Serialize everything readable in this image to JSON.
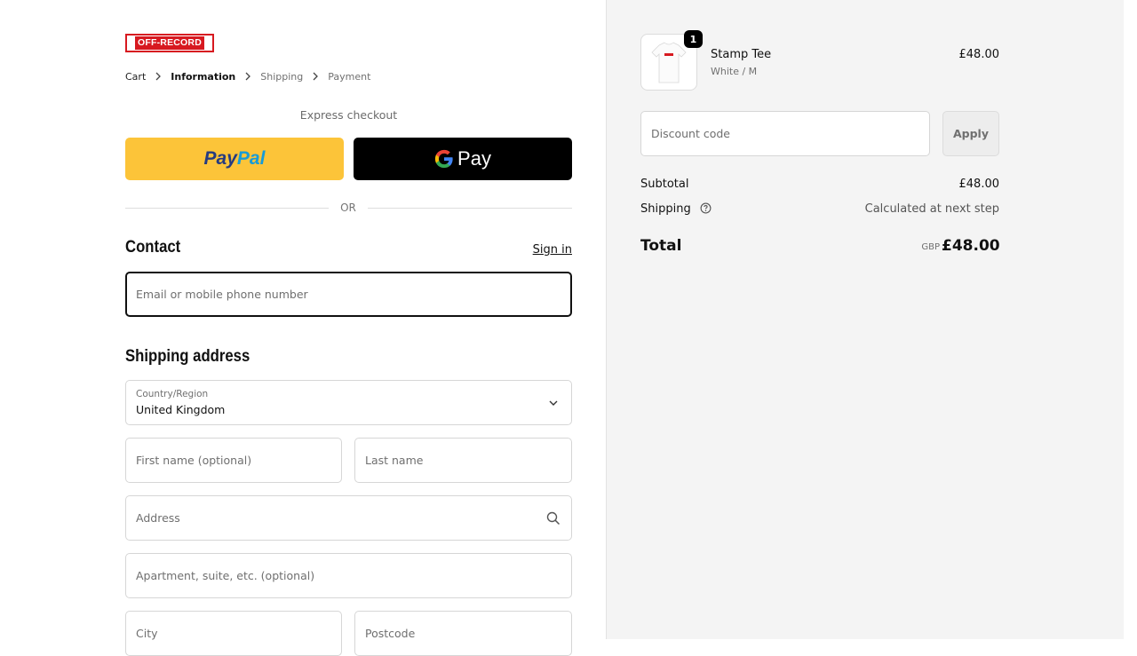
{
  "brand": {
    "logo_text": "OFF-RECORD",
    "accent": "#d71920"
  },
  "breadcrumb": [
    {
      "label": "Cart",
      "state": "link"
    },
    {
      "label": "Information",
      "state": "current"
    },
    {
      "label": "Shipping",
      "state": "upcoming"
    },
    {
      "label": "Payment",
      "state": "upcoming"
    }
  ],
  "express": {
    "title": "Express checkout",
    "paypal": {
      "label_part1": "Pay",
      "label_part2": "Pal",
      "bg": "#fcc439"
    },
    "gpay": {
      "label": "Pay",
      "bg": "#000000"
    },
    "divider": "OR"
  },
  "contact": {
    "heading": "Contact",
    "sign_in": "Sign in",
    "email_placeholder": "Email or mobile phone number"
  },
  "shipping_address": {
    "heading": "Shipping address",
    "country_label": "Country/Region",
    "country_value": "United Kingdom",
    "first_name_placeholder": "First name (optional)",
    "last_name_placeholder": "Last name",
    "address_placeholder": "Address",
    "apartment_placeholder": "Apartment, suite, etc. (optional)",
    "city_placeholder": "City",
    "postcode_placeholder": "Postcode"
  },
  "summary": {
    "item": {
      "name": "Stamp Tee",
      "variant": "White / M",
      "price": "£48.00",
      "quantity": "1"
    },
    "discount": {
      "placeholder": "Discount code",
      "apply": "Apply"
    },
    "subtotal_label": "Subtotal",
    "subtotal_value": "£48.00",
    "shipping_label": "Shipping",
    "shipping_value": "Calculated at next step",
    "total_label": "Total",
    "total_currency": "GBP",
    "total_value": "£48.00"
  }
}
